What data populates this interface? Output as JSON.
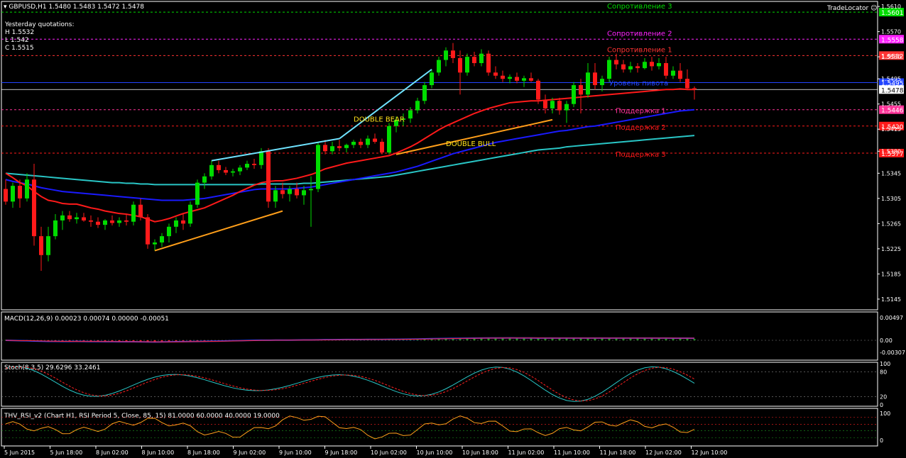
{
  "header": {
    "symbol": "GBPUSD,H1",
    "ohlc": "1.5480 1.5483 1.5472 1.5478",
    "tool": "TradeLocator"
  },
  "yesterday": {
    "title": "Yesterday quotations:",
    "high": "H 1.5532",
    "low": "L 1.542",
    "close": "C 1.5515"
  },
  "colors": {
    "bull": "#00dd00",
    "bear": "#ff1a1a",
    "grid": "#606060",
    "ma_fast": "#ff1a1a",
    "ma_mid": "#1a1aff",
    "ma_slow": "#29c6c6",
    "orange": "#ff9f1a",
    "cyan": "#6fe3ff"
  },
  "chart_data": {
    "type": "candlestick",
    "ylim": [
      1.5128,
      1.5618
    ],
    "price_ticks": [
      "1.5610",
      "1.5570",
      "1.5530",
      "1.5495",
      "1.5455",
      "1.5415",
      "1.5380",
      "1.5345",
      "1.5305",
      "1.5265",
      "1.5225",
      "1.5185",
      "1.5145"
    ],
    "x_labels": [
      "5 Jun 2015",
      "5 Jun 18:00",
      "8 Jun 02:00",
      "8 Jun 10:00",
      "8 Jun 18:00",
      "9 Jun 02:00",
      "9 Jun 10:00",
      "9 Jun 18:00",
      "10 Jun 02:00",
      "10 Jun 10:00",
      "10 Jun 18:00",
      "11 Jun 02:00",
      "11 Jun 10:00",
      "11 Jun 18:00",
      "12 Jun 02:00",
      "12 Jun 10:00"
    ],
    "candles": [
      [
        1.532,
        1.5335,
        1.5295,
        1.53
      ],
      [
        1.53,
        1.533,
        1.529,
        1.5325
      ],
      [
        1.5325,
        1.5335,
        1.529,
        1.5305
      ],
      [
        1.5305,
        1.5345,
        1.53,
        1.5335
      ],
      [
        1.5335,
        1.536,
        1.523,
        1.5245
      ],
      [
        1.5245,
        1.526,
        1.519,
        1.5215
      ],
      [
        1.5215,
        1.526,
        1.5205,
        1.5245
      ],
      [
        1.5245,
        1.528,
        1.524,
        1.527
      ],
      [
        1.527,
        1.5285,
        1.5255,
        1.5278
      ],
      [
        1.5278,
        1.5285,
        1.5268,
        1.5272
      ],
      [
        1.5272,
        1.5282,
        1.5265,
        1.5275
      ],
      [
        1.5275,
        1.5282,
        1.5268,
        1.527
      ],
      [
        1.527,
        1.5278,
        1.526,
        1.5268
      ],
      [
        1.5268,
        1.5275,
        1.5258,
        1.5263
      ],
      [
        1.5263,
        1.5272,
        1.5255,
        1.527
      ],
      [
        1.527,
        1.5278,
        1.5262,
        1.5266
      ],
      [
        1.5266,
        1.5275,
        1.526,
        1.527
      ],
      [
        1.527,
        1.528,
        1.5262,
        1.5268
      ],
      [
        1.5268,
        1.53,
        1.5262,
        1.5295
      ],
      [
        1.5295,
        1.5305,
        1.527,
        1.5275
      ],
      [
        1.5275,
        1.528,
        1.5225,
        1.5232
      ],
      [
        1.5232,
        1.524,
        1.5222,
        1.5235
      ],
      [
        1.5235,
        1.525,
        1.5228,
        1.5245
      ],
      [
        1.5245,
        1.5265,
        1.5235,
        1.526
      ],
      [
        1.526,
        1.5275,
        1.525,
        1.527
      ],
      [
        1.527,
        1.528,
        1.5255,
        1.5265
      ],
      [
        1.5265,
        1.53,
        1.526,
        1.5295
      ],
      [
        1.5295,
        1.5335,
        1.529,
        1.533
      ],
      [
        1.533,
        1.5345,
        1.532,
        1.534
      ],
      [
        1.534,
        1.5365,
        1.5335,
        1.5358
      ],
      [
        1.5358,
        1.5365,
        1.5345,
        1.535
      ],
      [
        1.535,
        1.5355,
        1.5342,
        1.5346
      ],
      [
        1.5346,
        1.5352,
        1.534,
        1.5348
      ],
      [
        1.5348,
        1.5358,
        1.5342,
        1.5354
      ],
      [
        1.5354,
        1.5365,
        1.535,
        1.536
      ],
      [
        1.536,
        1.5368,
        1.5352,
        1.5358
      ],
      [
        1.5358,
        1.5385,
        1.5352,
        1.538
      ],
      [
        1.538,
        1.5385,
        1.529,
        1.53
      ],
      [
        1.53,
        1.5325,
        1.529,
        1.5318
      ],
      [
        1.5318,
        1.533,
        1.5305,
        1.5312
      ],
      [
        1.5312,
        1.5325,
        1.53,
        1.532
      ],
      [
        1.532,
        1.533,
        1.5305,
        1.531
      ],
      [
        1.531,
        1.5325,
        1.5295,
        1.5318
      ],
      [
        1.5318,
        1.534,
        1.526,
        1.532
      ],
      [
        1.532,
        1.5395,
        1.5315,
        1.539
      ],
      [
        1.539,
        1.5398,
        1.5375,
        1.538
      ],
      [
        1.538,
        1.5395,
        1.5375,
        1.5388
      ],
      [
        1.5388,
        1.5398,
        1.538,
        1.5385
      ],
      [
        1.5385,
        1.5392,
        1.5378,
        1.539
      ],
      [
        1.539,
        1.5398,
        1.5385,
        1.5395
      ],
      [
        1.5395,
        1.54,
        1.5385,
        1.539
      ],
      [
        1.539,
        1.5405,
        1.5385,
        1.54
      ],
      [
        1.54,
        1.5408,
        1.5392,
        1.5395
      ],
      [
        1.5395,
        1.54,
        1.5375,
        1.5378
      ],
      [
        1.5378,
        1.5425,
        1.5375,
        1.542
      ],
      [
        1.542,
        1.5435,
        1.541,
        1.543
      ],
      [
        1.543,
        1.544,
        1.542,
        1.5432
      ],
      [
        1.5432,
        1.545,
        1.5425,
        1.5445
      ],
      [
        1.5445,
        1.5465,
        1.544,
        1.546
      ],
      [
        1.546,
        1.549,
        1.5455,
        1.5485
      ],
      [
        1.5485,
        1.551,
        1.548,
        1.5505
      ],
      [
        1.5505,
        1.553,
        1.55,
        1.5525
      ],
      [
        1.5525,
        1.5545,
        1.5515,
        1.554
      ],
      [
        1.554,
        1.5552,
        1.552,
        1.5528
      ],
      [
        1.5528,
        1.554,
        1.547,
        1.5505
      ],
      [
        1.5505,
        1.5535,
        1.55,
        1.553
      ],
      [
        1.553,
        1.5538,
        1.5515,
        1.552
      ],
      [
        1.552,
        1.5542,
        1.5515,
        1.5535
      ],
      [
        1.5535,
        1.554,
        1.55,
        1.5505
      ],
      [
        1.5505,
        1.5515,
        1.5495,
        1.55
      ],
      [
        1.55,
        1.5508,
        1.549,
        1.5495
      ],
      [
        1.5495,
        1.5502,
        1.5488,
        1.5498
      ],
      [
        1.5498,
        1.5505,
        1.5488,
        1.5492
      ],
      [
        1.5492,
        1.55,
        1.5482,
        1.5496
      ],
      [
        1.5496,
        1.5505,
        1.549,
        1.5492
      ],
      [
        1.5492,
        1.5495,
        1.5455,
        1.5462
      ],
      [
        1.5462,
        1.547,
        1.544,
        1.5448
      ],
      [
        1.5448,
        1.5465,
        1.544,
        1.546
      ],
      [
        1.546,
        1.5465,
        1.5438,
        1.5445
      ],
      [
        1.5445,
        1.546,
        1.5425,
        1.5455
      ],
      [
        1.5455,
        1.549,
        1.545,
        1.5485
      ],
      [
        1.5485,
        1.5495,
        1.544,
        1.547
      ],
      [
        1.547,
        1.552,
        1.5465,
        1.5505
      ],
      [
        1.5505,
        1.552,
        1.5478,
        1.5485
      ],
      [
        1.5485,
        1.55,
        1.5475,
        1.5495
      ],
      [
        1.5495,
        1.553,
        1.549,
        1.5525
      ],
      [
        1.5525,
        1.5535,
        1.551,
        1.5518
      ],
      [
        1.5518,
        1.5525,
        1.5505,
        1.551
      ],
      [
        1.551,
        1.5522,
        1.5505,
        1.5515
      ],
      [
        1.5515,
        1.552,
        1.5505,
        1.5512
      ],
      [
        1.5512,
        1.5528,
        1.551,
        1.5522
      ],
      [
        1.5522,
        1.553,
        1.5508,
        1.5515
      ],
      [
        1.5515,
        1.5528,
        1.551,
        1.552
      ],
      [
        1.552,
        1.553,
        1.5495,
        1.55
      ],
      [
        1.55,
        1.5515,
        1.5495,
        1.5508
      ],
      [
        1.5508,
        1.552,
        1.549,
        1.5495
      ],
      [
        1.5495,
        1.551,
        1.5478,
        1.548
      ],
      [
        1.548,
        1.5483,
        1.5462,
        1.5478
      ]
    ],
    "ma_fast": [
      1.5345,
      1.5338,
      1.533,
      1.5325,
      1.5316,
      1.5308,
      1.5302,
      1.53,
      1.5297,
      1.5296,
      1.5296,
      1.5293,
      1.529,
      1.5288,
      1.5285,
      1.5283,
      1.5281,
      1.528,
      1.5278,
      1.5276,
      1.5272,
      1.5268,
      1.527,
      1.5273,
      1.5277,
      1.5281,
      1.5284,
      1.5287,
      1.529,
      1.5295,
      1.53,
      1.5305,
      1.531,
      1.5316,
      1.5321,
      1.5326,
      1.533,
      1.5332,
      1.5333,
      1.5333,
      1.5335,
      1.5337,
      1.534,
      1.5343,
      1.5347,
      1.5352,
      1.5355,
      1.5358,
      1.5361,
      1.5363,
      1.5365,
      1.5367,
      1.5369,
      1.5371,
      1.5373,
      1.5377,
      1.5382,
      1.5387,
      1.5393,
      1.54,
      1.5407,
      1.5414,
      1.542,
      1.5425,
      1.543,
      1.5435,
      1.544,
      1.5444,
      1.5448,
      1.5451,
      1.5454,
      1.5457,
      1.5458,
      1.5459,
      1.546,
      1.546,
      1.5461,
      1.5462,
      1.5463,
      1.5464,
      1.5465,
      1.5466,
      1.5467,
      1.5468,
      1.5469,
      1.547,
      1.5471,
      1.5472,
      1.5473,
      1.5474,
      1.5475,
      1.5476,
      1.5477,
      1.5478,
      1.5478,
      1.5479,
      1.5478,
      1.5478
    ],
    "ma_mid": [
      1.5335,
      1.5332,
      1.533,
      1.5328,
      1.5325,
      1.5322,
      1.532,
      1.5318,
      1.5316,
      1.5315,
      1.5314,
      1.5313,
      1.5312,
      1.5311,
      1.531,
      1.5309,
      1.5308,
      1.5307,
      1.5306,
      1.5305,
      1.5304,
      1.5303,
      1.5302,
      1.5302,
      1.5302,
      1.5302,
      1.5303,
      1.5304,
      1.5305,
      1.5307,
      1.5309,
      1.5311,
      1.5313,
      1.5315,
      1.5317,
      1.5319,
      1.532,
      1.532,
      1.532,
      1.532,
      1.532,
      1.5321,
      1.5322,
      1.5323,
      1.5325,
      1.5327,
      1.5329,
      1.5331,
      1.5333,
      1.5335,
      1.5337,
      1.5339,
      1.5341,
      1.5343,
      1.5345,
      1.5347,
      1.535,
      1.5353,
      1.5356,
      1.536,
      1.5364,
      1.5368,
      1.5372,
      1.5376,
      1.5379,
      1.5382,
      1.5385,
      1.5388,
      1.5391,
      1.5394,
      1.5396,
      1.5398,
      1.54,
      1.5402,
      1.5404,
      1.5406,
      1.5408,
      1.541,
      1.5412,
      1.5413,
      1.5415,
      1.5417,
      1.5419,
      1.542,
      1.5422,
      1.5424,
      1.5426,
      1.5428,
      1.543,
      1.5432,
      1.5434,
      1.5436,
      1.5438,
      1.544,
      1.5442,
      1.5444,
      1.5445,
      1.5446
    ],
    "ma_slow": [
      1.5345,
      1.5344,
      1.5343,
      1.5342,
      1.5341,
      1.534,
      1.5339,
      1.5338,
      1.5337,
      1.5336,
      1.5335,
      1.5334,
      1.5333,
      1.5332,
      1.5331,
      1.533,
      1.533,
      1.5329,
      1.5329,
      1.5328,
      1.5328,
      1.5327,
      1.5327,
      1.5327,
      1.5327,
      1.5327,
      1.5327,
      1.5327,
      1.5327,
      1.5327,
      1.5327,
      1.5327,
      1.5327,
      1.5327,
      1.5327,
      1.5327,
      1.5328,
      1.5328,
      1.5328,
      1.5328,
      1.5328,
      1.5328,
      1.5329,
      1.5329,
      1.533,
      1.5331,
      1.5332,
      1.5333,
      1.5334,
      1.5335,
      1.5336,
      1.5337,
      1.5338,
      1.5339,
      1.534,
      1.5342,
      1.5344,
      1.5346,
      1.5348,
      1.535,
      1.5352,
      1.5354,
      1.5356,
      1.5358,
      1.536,
      1.5362,
      1.5364,
      1.5366,
      1.5368,
      1.537,
      1.5372,
      1.5374,
      1.5376,
      1.5378,
      1.538,
      1.5382,
      1.5383,
      1.5384,
      1.5385,
      1.5387,
      1.5388,
      1.5389,
      1.539,
      1.5391,
      1.5392,
      1.5393,
      1.5394,
      1.5395,
      1.5396,
      1.5397,
      1.5398,
      1.5399,
      1.54,
      1.5401,
      1.5402,
      1.5403,
      1.5404,
      1.5405
    ],
    "levels": [
      {
        "name": "Сопротивление 3",
        "value": 1.5601,
        "color": "#00dd00",
        "tag": "1.5601"
      },
      {
        "name": "Сопротивление 2",
        "value": 1.5558,
        "color": "#ff22ff",
        "tag": "1.5558"
      },
      {
        "name": "Сопротивление 1",
        "value": 1.5532,
        "color": "#ff3333",
        "tag": "1.5532"
      },
      {
        "name": "Уровень пивота",
        "value": 1.5489,
        "color": "#2244ff",
        "tag": "1.5495"
      },
      {
        "name": "Поддержка 1",
        "value": 1.5446,
        "color": "#ff3399",
        "tag": "1.5446"
      },
      {
        "name": "Поддержка 2",
        "value": 1.542,
        "color": "#ff1a1a",
        "tag": "1.5420"
      },
      {
        "name": "Поддержка 3",
        "value": 1.5377,
        "color": "#ff1a1a",
        "tag": "1.5377"
      }
    ],
    "current_price": "1.5478",
    "annotations": [
      {
        "text": "DOUBLE BEAR",
        "color": "#ffe21a"
      },
      {
        "text": "DOUBLE BULL",
        "color": "#ffe21a"
      }
    ],
    "panels": {
      "macd": {
        "label": "MACD(12,26,9) 0.00023 0.00074 0.00000 -0.00051",
        "ticks": [
          "0.00497",
          "0.00",
          "-0.00307"
        ]
      },
      "stoch": {
        "label": "Stoch(8,3,5) 29.6296 33.2461",
        "ticks": [
          "100",
          "80",
          "20",
          "0"
        ]
      },
      "rsi": {
        "label": "THV_RSI_v2 (Chart H1, RSI Period 5, Close, 85, 15) 81.0000 60.0000 40.0000 19.0000",
        "ticks": [
          "100",
          "0"
        ]
      }
    }
  }
}
